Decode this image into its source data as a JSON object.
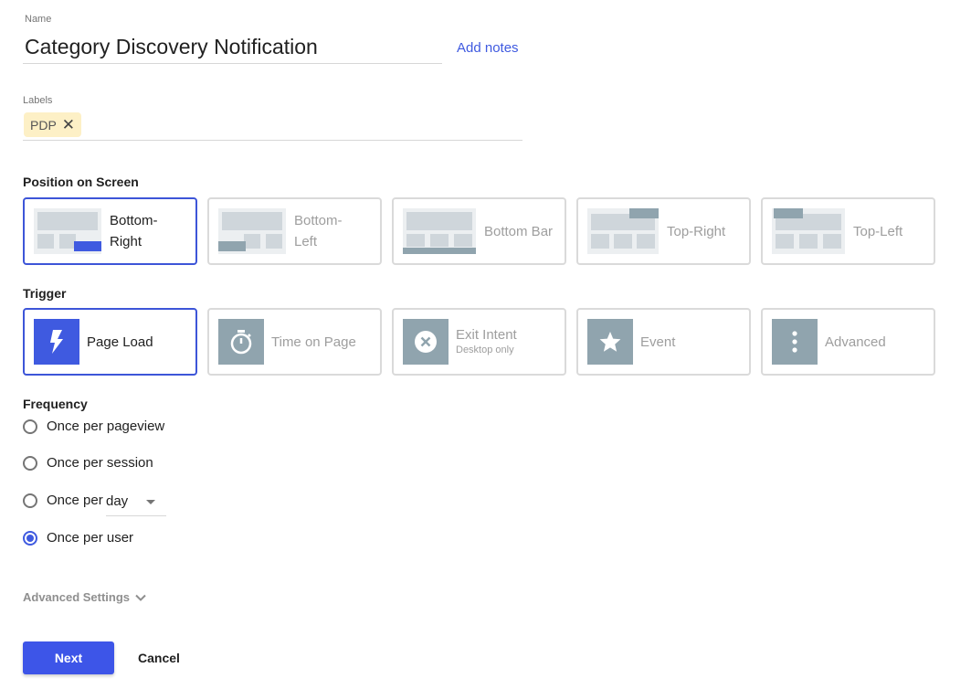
{
  "name_field": {
    "label": "Name",
    "value": "Category Discovery Notification"
  },
  "add_notes_label": "Add notes",
  "labels_field": {
    "label": "Labels",
    "chips": [
      "PDP"
    ]
  },
  "position": {
    "title": "Position on Screen",
    "options": [
      {
        "line1": "Bottom-",
        "line2": "Right",
        "selected": true
      },
      {
        "line1": "Bottom-",
        "line2": "Left",
        "selected": false
      },
      {
        "line1": "Bottom Bar",
        "line2": "",
        "selected": false
      },
      {
        "line1": "Top-Right",
        "line2": "",
        "selected": false
      },
      {
        "line1": "Top-Left",
        "line2": "",
        "selected": false
      }
    ]
  },
  "trigger": {
    "title": "Trigger",
    "options": [
      {
        "label": "Page Load",
        "sub": "",
        "icon": "lightning-icon",
        "selected": true
      },
      {
        "label": "Time on Page",
        "sub": "",
        "icon": "stopwatch-icon",
        "selected": false
      },
      {
        "label": "Exit Intent",
        "sub": "Desktop only",
        "icon": "close-circle-icon",
        "selected": false
      },
      {
        "label": "Event",
        "sub": "",
        "icon": "star-icon",
        "selected": false
      },
      {
        "label": "Advanced",
        "sub": "",
        "icon": "more-vertical-icon",
        "selected": false
      }
    ]
  },
  "frequency": {
    "title": "Frequency",
    "options": [
      {
        "label": "Once per pageview",
        "checked": false
      },
      {
        "label": "Once per session",
        "checked": false
      },
      {
        "label": "Once per",
        "checked": false
      },
      {
        "label": "Once per user",
        "checked": true
      }
    ],
    "day_select_value": "day"
  },
  "advanced_settings_label": "Advanced Settings",
  "buttons": {
    "next": "Next",
    "cancel": "Cancel"
  },
  "colors": {
    "accent": "#3f5ae0",
    "chip_bg": "#fdf0c6",
    "inactive_icon": "#90a4ae"
  }
}
